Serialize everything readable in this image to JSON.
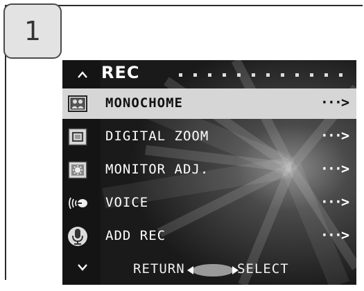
{
  "step": {
    "number": "1"
  },
  "screen": {
    "header": {
      "title": "REC",
      "up_icon": "chevron-up-icon"
    },
    "items": [
      {
        "label": "MONOCHOME",
        "arrow": "···>",
        "icon": "monochrome-icon",
        "selected": true
      },
      {
        "label": "DIGITAL ZOOM",
        "arrow": "···>",
        "icon": "digital-zoom-icon",
        "selected": false
      },
      {
        "label": "MONITOR ADJ.",
        "arrow": "···>",
        "icon": "monitor-adjust-icon",
        "selected": false
      },
      {
        "label": "VOICE",
        "arrow": "···>",
        "icon": "voice-icon",
        "selected": false
      },
      {
        "label": "ADD REC",
        "arrow": "···>",
        "icon": "microphone-icon",
        "selected": false
      }
    ],
    "footer": {
      "return_label": "RETURN",
      "select_label": "SELECT",
      "down_icon": "chevron-down-icon"
    }
  },
  "colors": {
    "screen_bg": "#1b1b1b",
    "selected_row": "#d6d6d6",
    "text": "#ffffff"
  }
}
